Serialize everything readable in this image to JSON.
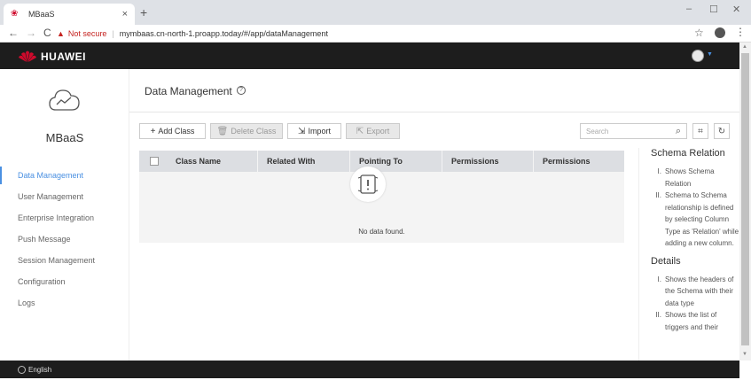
{
  "browser": {
    "tab_title": "MBaaS",
    "new_tab": "+",
    "tab_close": "×",
    "security_label": "Not secure",
    "url": "mymbaas.cn-north-1.proapp.today/#/app/dataManagement",
    "controls": {
      "minimize": "–",
      "maximize": "☐",
      "close": "✕"
    },
    "nav": {
      "back": "←",
      "forward": "→",
      "reload": "C"
    }
  },
  "header": {
    "logo_text": "HUAWEI"
  },
  "sidebar": {
    "brand": "MBaaS",
    "items": [
      {
        "label": "Data Management"
      },
      {
        "label": "User Management"
      },
      {
        "label": "Enterprise Integration"
      },
      {
        "label": "Push Message"
      },
      {
        "label": "Session Management"
      },
      {
        "label": "Configuration"
      },
      {
        "label": "Logs"
      }
    ]
  },
  "main": {
    "title": "Data Management",
    "help_icon_glyph": "?",
    "toolbar": {
      "add_class": "Add Class",
      "delete_class": "Delete Class",
      "import": "Import",
      "export": "Export",
      "search_placeholder": "Search"
    },
    "table": {
      "columns": [
        "Class Name",
        "Related With",
        "Pointing To",
        "Permissions",
        "Permissions"
      ],
      "empty_text": "No data found."
    }
  },
  "help_panel": {
    "schema_heading": "Schema Relation",
    "schema_items": [
      {
        "num": "I.",
        "text": "Shows Schema Relation"
      },
      {
        "num": "II.",
        "text": "Schema to Schema relationship is defined by selecting Column Type as 'Relation' while adding a new column."
      }
    ],
    "details_heading": "Details",
    "details_items": [
      {
        "num": "I.",
        "text": "Shows the headers of the Schema with their data type"
      },
      {
        "num": "II.",
        "text": "Shows the list of triggers and their"
      }
    ]
  },
  "footer": {
    "language": "English"
  },
  "icons": {
    "accent": "#4a90e2",
    "brand_red": "#cf0a2c",
    "header_bg": "#1d1d1d"
  }
}
